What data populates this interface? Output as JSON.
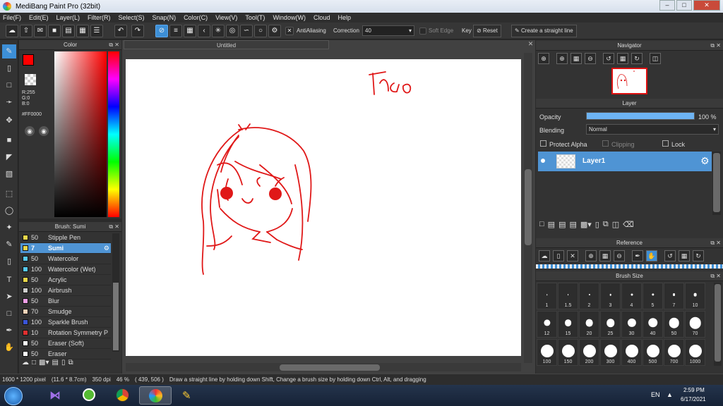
{
  "window": {
    "title": "MediBang Paint Pro (32bit)"
  },
  "menu": [
    "File(F)",
    "Edit(E)",
    "Layer(L)",
    "Filter(R)",
    "Select(S)",
    "Snap(N)",
    "Color(C)",
    "View(V)",
    "Tool(T)",
    "Window(W)",
    "Cloud",
    "Help"
  ],
  "toolbar": {
    "antialiasing_label": "AntiAliasing",
    "correction_label": "Correction",
    "correction_value": "40",
    "soft_edge_label": "Soft Edge",
    "key_label": "Key",
    "reset_label": "Reset",
    "straight_line_label": "Create a straight line"
  },
  "color_panel": {
    "title": "Color",
    "r": "R:255",
    "g": "G:0",
    "b": "B:0",
    "hex": "#FF0000",
    "primary_color": "#ff0000"
  },
  "brush_panel": {
    "title": "Brush: Sumi",
    "brushes": [
      {
        "size": "50",
        "name": "Stipple Pen",
        "color": "#e8d64a"
      },
      {
        "size": "7",
        "name": "Sumi",
        "color": "#e8d64a",
        "selected": true
      },
      {
        "size": "50",
        "name": "Watercolor",
        "color": "#56c9f0"
      },
      {
        "size": "100",
        "name": "Watercolor (Wet)",
        "color": "#56c9f0"
      },
      {
        "size": "50",
        "name": "Acrylic",
        "color": "#e8d64a"
      },
      {
        "size": "100",
        "name": "Airbrush",
        "color": "#cfcfcf"
      },
      {
        "size": "50",
        "name": "Blur",
        "color": "#f0a0e8"
      },
      {
        "size": "70",
        "name": "Smudge",
        "color": "#f4d3b8"
      },
      {
        "size": "100",
        "name": "Sparkle Brush",
        "color": "#3a55d8"
      },
      {
        "size": "10",
        "name": "Rotation Symmetry P",
        "color": "#e03030"
      },
      {
        "size": "50",
        "name": "Eraser (Soft)",
        "color": "#ffffff"
      },
      {
        "size": "50",
        "name": "Eraser",
        "color": "#ffffff"
      }
    ]
  },
  "document": {
    "tab_title": "Untitled",
    "drawn_text": "Thảo"
  },
  "navigator": {
    "title": "Navigator"
  },
  "layer_panel": {
    "title": "Layer",
    "opacity_label": "Opacity",
    "opacity_value": "100 %",
    "opacity_fraction": 1.0,
    "blending_label": "Blending",
    "blending_value": "Normal",
    "protect_alpha_label": "Protect Alpha",
    "clipping_label": "Clipping",
    "lock_label": "Lock",
    "layers": [
      {
        "name": "Layer1"
      }
    ]
  },
  "reference_panel": {
    "title": "Reference"
  },
  "brush_size_panel": {
    "title": "Brush Size",
    "sizes": [
      "1",
      "1.5",
      "2",
      "3",
      "4",
      "5",
      "7",
      "10",
      "12",
      "15",
      "20",
      "25",
      "30",
      "40",
      "50",
      "70",
      "100",
      "150",
      "200",
      "300",
      "400",
      "500",
      "700",
      "1000"
    ]
  },
  "status": {
    "size": "1600 * 1200 pixel",
    "cm": "(11.6 * 8.7cm)",
    "dpi": "350 dpi",
    "zoom": "46 %",
    "coords": "( 439, 506 )",
    "hint": "Draw a straight line by holding down Shift, Change a brush size by holding down Ctrl, Alt, and dragging"
  },
  "taskbar": {
    "lang": "EN",
    "time": "2:59 PM",
    "date": "6/17/2021"
  }
}
